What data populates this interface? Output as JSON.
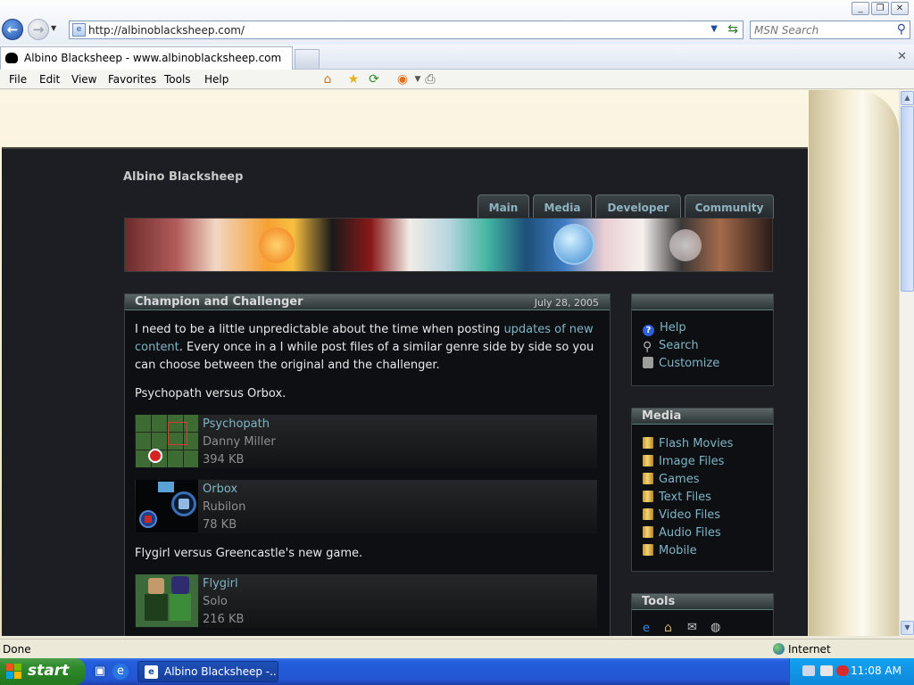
{
  "window": {
    "minimize": "_",
    "restore": "❐",
    "close": "✕"
  },
  "address_bar": {
    "url": "http://albinoblacksheep.com/",
    "search_placeholder": "MSN Search"
  },
  "tab": {
    "title": "Albino Blacksheep - www.albinoblacksheep.com"
  },
  "menu": {
    "items": [
      "File",
      "Edit",
      "View",
      "Favorites",
      "Tools",
      "Help"
    ]
  },
  "toolbar_icons": [
    "home-icon",
    "favorites-star-icon",
    "history-icon",
    "feeds-icon",
    "print-icon"
  ],
  "site": {
    "title": "Albino Blacksheep",
    "nav_tabs": [
      "Main",
      "Media",
      "Developer",
      "Community"
    ]
  },
  "article": {
    "title": "Champion and Challenger",
    "date": "July 28, 2005",
    "intro_before_link": "I need to be a little unpredictable about the time when posting ",
    "intro_link": "updates of new content",
    "intro_after_link": ". Every once in a I while post files of a similar genre side by side so you can choose between the original and the challenger.",
    "pair1_heading": "Psychopath versus Orbox.",
    "pair2_heading": "Flygirl versus Greencastle's new game.",
    "files": [
      {
        "name": "Psychopath",
        "author": "Danny Miller",
        "size": "394 KB"
      },
      {
        "name": "Orbox",
        "author": "Rubilon",
        "size": "78 KB"
      },
      {
        "name": "Flygirl",
        "author": "Solo",
        "size": "216 KB"
      }
    ]
  },
  "sidebar": {
    "account_links": [
      "Help",
      "Search",
      "Customize"
    ],
    "media_title": "Media",
    "media_links": [
      "Flash Movies",
      "Image Files",
      "Games",
      "Text Files",
      "Video Files",
      "Audio Files",
      "Mobile"
    ],
    "tools_title": "Tools"
  },
  "status_bar": {
    "status": "Done",
    "zone": "Internet"
  },
  "taskbar": {
    "start": "start",
    "task_title": "Albino Blacksheep -...",
    "clock": "11:08 AM"
  }
}
